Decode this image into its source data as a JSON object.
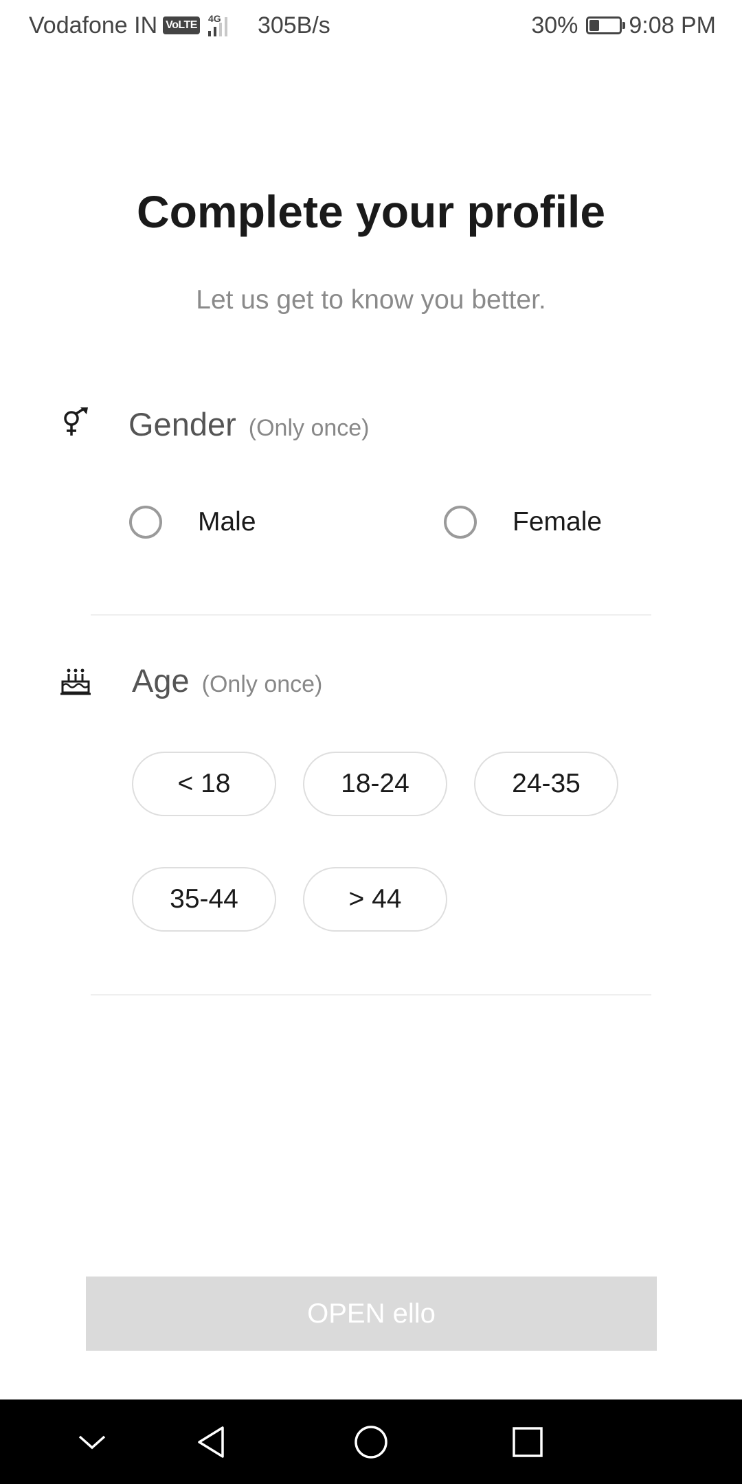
{
  "status_bar": {
    "carrier": "Vodafone IN",
    "volte": "VoLTE",
    "network_type": "4G",
    "net_rate": "305B/s",
    "battery_percent": "30%",
    "battery_level": 0.3,
    "time": "9:08 PM"
  },
  "header": {
    "title": "Complete your profile",
    "subtitle": "Let us get to know you better."
  },
  "gender": {
    "label": "Gender",
    "note": "(Only once)",
    "icon": "gender-icon",
    "options": [
      {
        "label": "Male",
        "selected": false
      },
      {
        "label": "Female",
        "selected": false
      }
    ]
  },
  "age": {
    "label": "Age",
    "note": "(Only once)",
    "icon": "cake-icon",
    "options": [
      "< 18",
      "18-24",
      "24-35",
      "35-44",
      "> 44"
    ]
  },
  "open_button": {
    "label": "OPEN ello",
    "background": "#dadada",
    "text_color": "#ffffff"
  },
  "nav_bar": {
    "buttons": [
      "collapse-icon",
      "back-icon",
      "home-icon",
      "recents-icon"
    ]
  }
}
